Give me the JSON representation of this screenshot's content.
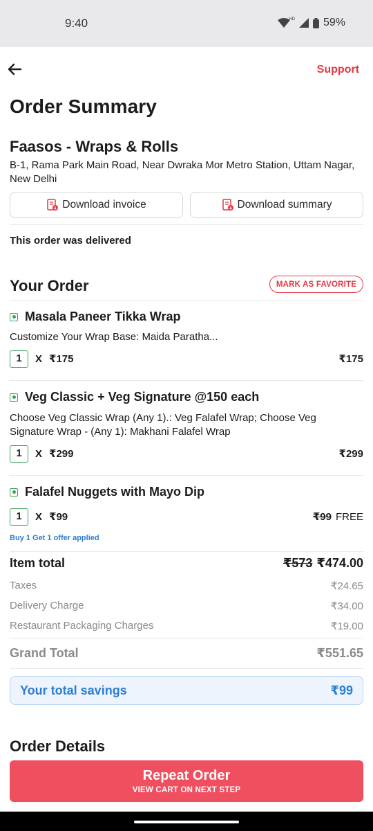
{
  "status_bar": {
    "time": "9:40",
    "battery": "59%",
    "network": "HD"
  },
  "header": {
    "support_label": "Support"
  },
  "page_title": "Order Summary",
  "restaurant": {
    "name": "Faasos - Wraps & Rolls",
    "address": "B-1, Rama Park Main Road, Near Dwraka Mor Metro Station, Uttam Nagar, New Delhi"
  },
  "buttons": {
    "download_invoice": "Download invoice",
    "download_summary": "Download summary"
  },
  "delivery_status": "This order was delivered",
  "your_order": {
    "title": "Your Order",
    "favorite_label": "MARK AS FAVORITE",
    "items": [
      {
        "name": "Masala Paneer Tikka Wrap",
        "description": "Customize Your Wrap Base: Maida Paratha...",
        "qty": "1",
        "x": "X",
        "unit_price": "₹175",
        "total": "₹175"
      },
      {
        "name": "Veg Classic + Veg Signature @150 each",
        "description": "Choose Veg Classic Wrap (Any 1).: Veg Falafel Wrap; Choose Veg Signature Wrap - (Any 1): Makhani Falafel Wrap",
        "qty": "1",
        "x": "X",
        "unit_price": "₹299",
        "total": "₹299"
      },
      {
        "name": "Falafel Nuggets with Mayo Dip",
        "qty": "1",
        "x": "X",
        "unit_price": "₹99",
        "original_total": "₹99",
        "total": "FREE",
        "offer": "Buy 1 Get 1 offer applied"
      }
    ]
  },
  "bill": {
    "item_total_label": "Item total",
    "item_total_original": "₹573",
    "item_total": "₹474.00",
    "taxes_label": "Taxes",
    "taxes": "₹24.65",
    "delivery_label": "Delivery Charge",
    "delivery": "₹34.00",
    "packaging_label": "Restaurant Packaging Charges",
    "packaging": "₹19.00",
    "grand_total_label": "Grand Total",
    "grand_total": "₹551.65"
  },
  "savings": {
    "label": "Your total savings",
    "amount": "₹99"
  },
  "order_details_title": "Order Details",
  "repeat": {
    "label": "Repeat Order",
    "sub_label": "VIEW CART ON NEXT STEP"
  },
  "colors": {
    "accent": "#e23744",
    "button": "#ef4f5f",
    "veg": "#3ea357",
    "savings": "#2d7dd2"
  }
}
